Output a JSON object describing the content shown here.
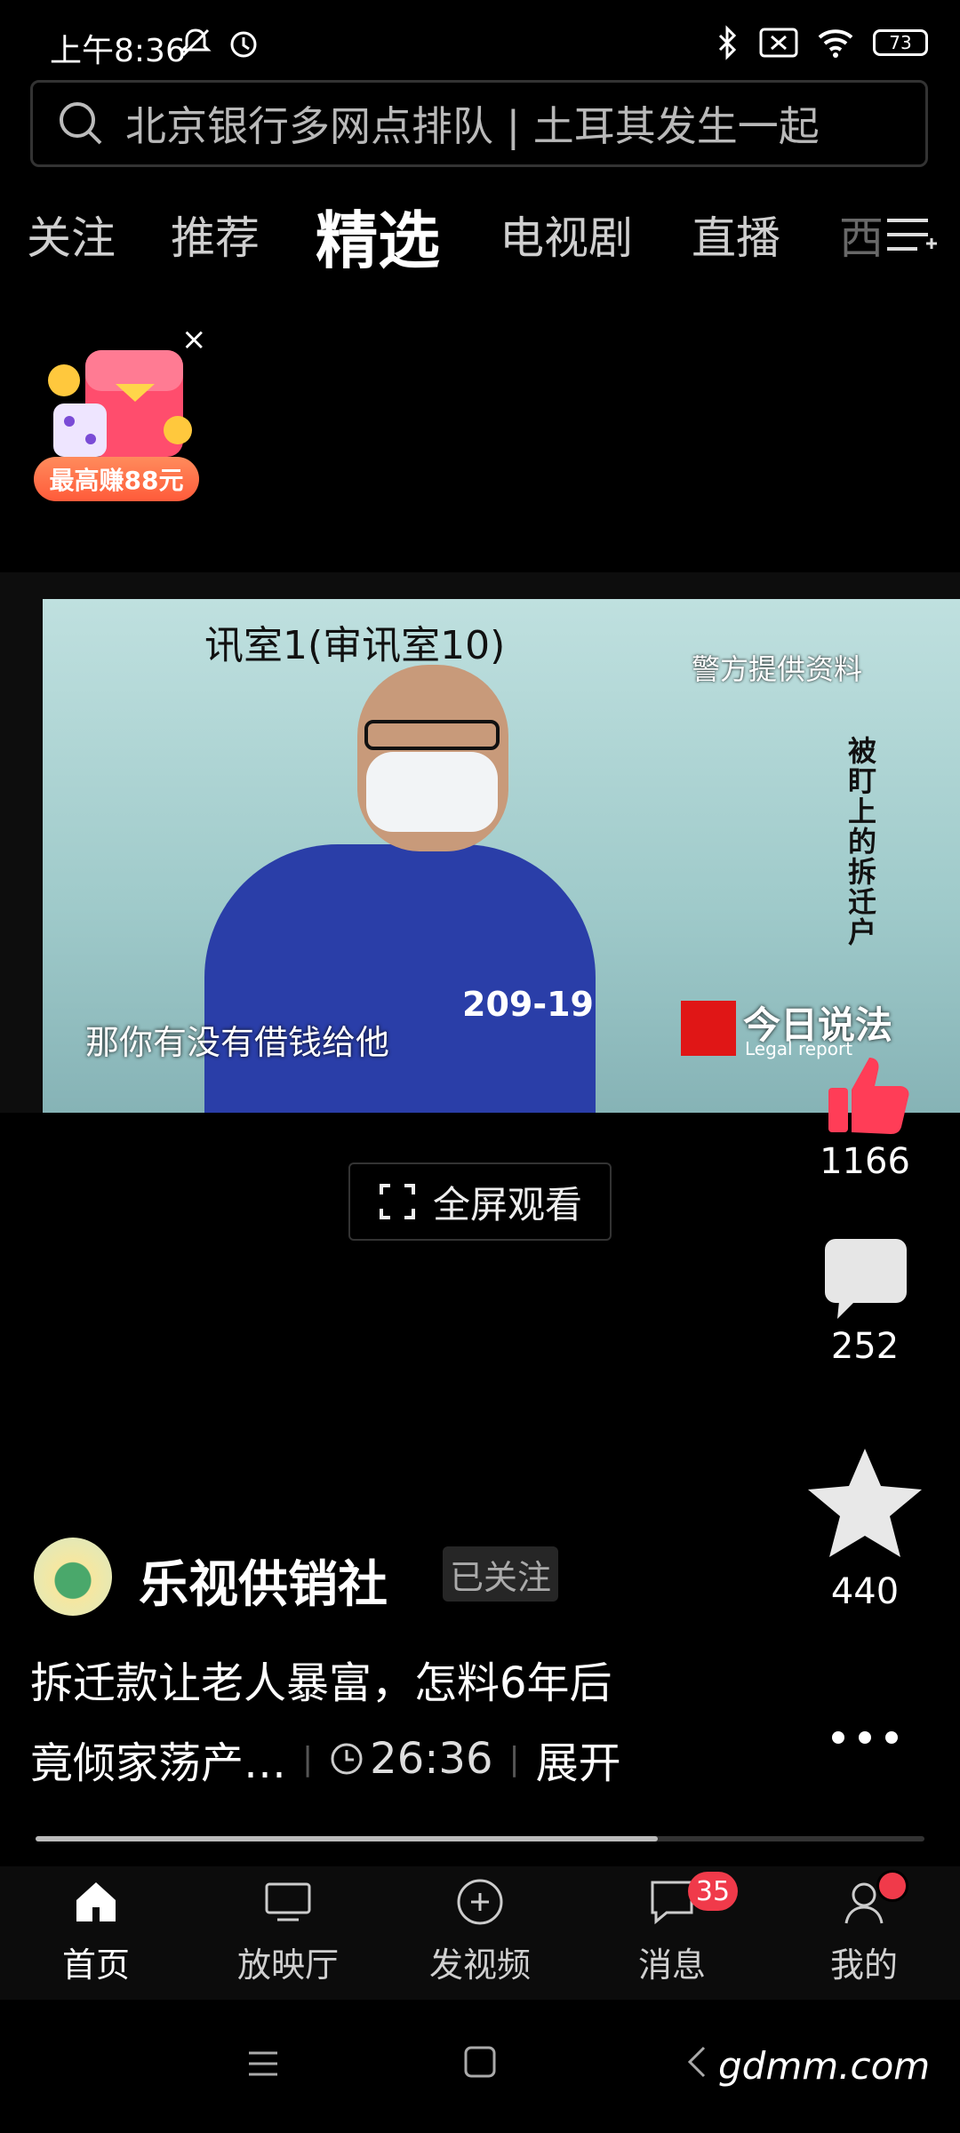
{
  "status_bar": {
    "time": "上午8:36",
    "battery": "73"
  },
  "search": {
    "placeholder": "北京银行多网点排队 | 土耳其发生一起"
  },
  "tabs": [
    {
      "label": "关注"
    },
    {
      "label": "推荐"
    },
    {
      "label": "精选",
      "active": true
    },
    {
      "label": "电视剧"
    },
    {
      "label": "直播"
    },
    {
      "label": "西"
    }
  ],
  "promo": {
    "label": "最高赚88元",
    "close": "×"
  },
  "video": {
    "room_text": "讯室1(审讯室10)",
    "police_text": "警方提供资料",
    "vertical_text": "被盯上的拆迁户",
    "caption": "那你有没有借钱给他",
    "vest_number": "209-19",
    "logo_text": "今日说法",
    "logo_sub": "Legal report"
  },
  "fullscreen_label": "全屏观看",
  "actions": {
    "likes": "1166",
    "comments": "252",
    "favorites": "440"
  },
  "author": {
    "name": "乐视供销社",
    "follow_label": "已关注"
  },
  "post": {
    "title_line1": "拆迁款让老人暴富，怎料6年后",
    "title_line2": "竟倾家荡产…",
    "duration": "26:36",
    "expand": "展开"
  },
  "progress": 0.7,
  "nav": [
    {
      "label": "首页",
      "icon": "home-icon"
    },
    {
      "label": "放映厅",
      "icon": "tv-icon"
    },
    {
      "label": "发视频",
      "icon": "plus-circle-icon"
    },
    {
      "label": "消息",
      "icon": "message-icon",
      "badge": "35"
    },
    {
      "label": "我的",
      "icon": "profile-icon"
    }
  ],
  "watermark": "gdmm.com",
  "colors": {
    "background": "#000000",
    "accent_red": "#f03a4a",
    "promo_orange": "#ff6a45"
  }
}
